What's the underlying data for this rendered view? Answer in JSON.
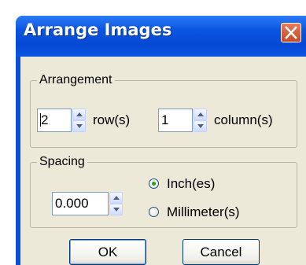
{
  "window": {
    "title": "Arrange Images"
  },
  "arrangement": {
    "legend": "Arrangement",
    "rows_value": "2",
    "rows_label": "row(s)",
    "columns_value": "1",
    "columns_label": "column(s)"
  },
  "spacing": {
    "legend": "Spacing",
    "value": "0.000",
    "units": [
      {
        "label": "Inch(es)",
        "selected": true
      },
      {
        "label": "Millimeter(s)",
        "selected": false
      }
    ]
  },
  "buttons": {
    "ok_label": "OK",
    "cancel_label": "Cancel"
  },
  "icons": {
    "close": "close-icon",
    "spin_up": "arrow-up-icon",
    "spin_down": "arrow-down-icon"
  },
  "colors": {
    "titlebar": "#0a55e0",
    "close_button": "#c94626",
    "dialog_bg": "#ece9d8",
    "radio_selected": "#21a121"
  }
}
